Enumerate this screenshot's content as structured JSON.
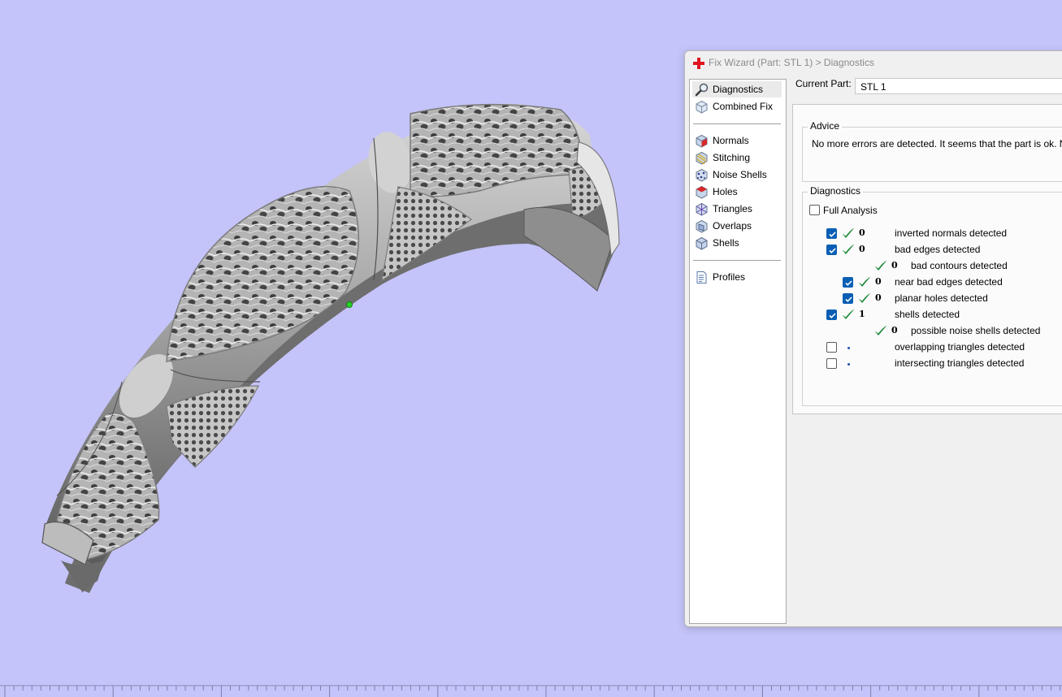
{
  "dialog": {
    "title": "Fix Wizard (Part: STL 1) > Diagnostics",
    "current_part_label": "Current Part:",
    "current_part_value": "STL 1"
  },
  "nav": {
    "items": [
      {
        "label": "Diagnostics",
        "icon": "magnifier-icon",
        "active": true
      },
      {
        "label": "Combined Fix",
        "icon": "cube-icon"
      },
      {
        "label": "Normals",
        "icon": "normals-cube-icon"
      },
      {
        "label": "Stitching",
        "icon": "stitching-icon"
      },
      {
        "label": "Noise Shells",
        "icon": "noise-shells-icon"
      },
      {
        "label": "Holes",
        "icon": "holes-cube-icon"
      },
      {
        "label": "Triangles",
        "icon": "triangles-icon"
      },
      {
        "label": "Overlaps",
        "icon": "overlaps-icon"
      },
      {
        "label": "Shells",
        "icon": "shells-icon"
      },
      {
        "label": "Profiles",
        "icon": "document-icon"
      }
    ]
  },
  "advice": {
    "title": "Advice",
    "text": "No more errors are detected. It seems that the part is ok. Note t"
  },
  "diagnostics": {
    "title": "Diagnostics",
    "full_analysis_label": "Full Analysis",
    "full_analysis_checked": false,
    "rows": [
      {
        "checked": true,
        "status": "ok",
        "count": "0",
        "label": "inverted normals detected",
        "level": 0
      },
      {
        "checked": true,
        "status": "ok",
        "count": "0",
        "label": "bad edges detected",
        "level": 0
      },
      {
        "checked": null,
        "status": "ok",
        "count": "0",
        "label": "bad contours detected",
        "level": 2
      },
      {
        "checked": true,
        "status": "ok",
        "count": "0",
        "label": "near bad edges detected",
        "level": 1
      },
      {
        "checked": true,
        "status": "ok",
        "count": "0",
        "label": "planar holes detected",
        "level": 1
      },
      {
        "checked": true,
        "status": "ok",
        "count": "1",
        "label": "shells detected",
        "level": 0
      },
      {
        "checked": null,
        "status": "ok",
        "count": "0",
        "label": "possible noise shells detected",
        "level": 2
      },
      {
        "checked": false,
        "status": "pending",
        "count": "",
        "label": "overlapping triangles detected",
        "level": 0
      },
      {
        "checked": false,
        "status": "pending",
        "count": "",
        "label": "intersecting triangles detected",
        "level": 0
      }
    ]
  },
  "colors": {
    "viewport_background": "#c4c4fa",
    "checkmark_green": "#1e8a3a",
    "checkbox_blue": "#0a5fb4",
    "title_icon_red": "#e0141e"
  }
}
